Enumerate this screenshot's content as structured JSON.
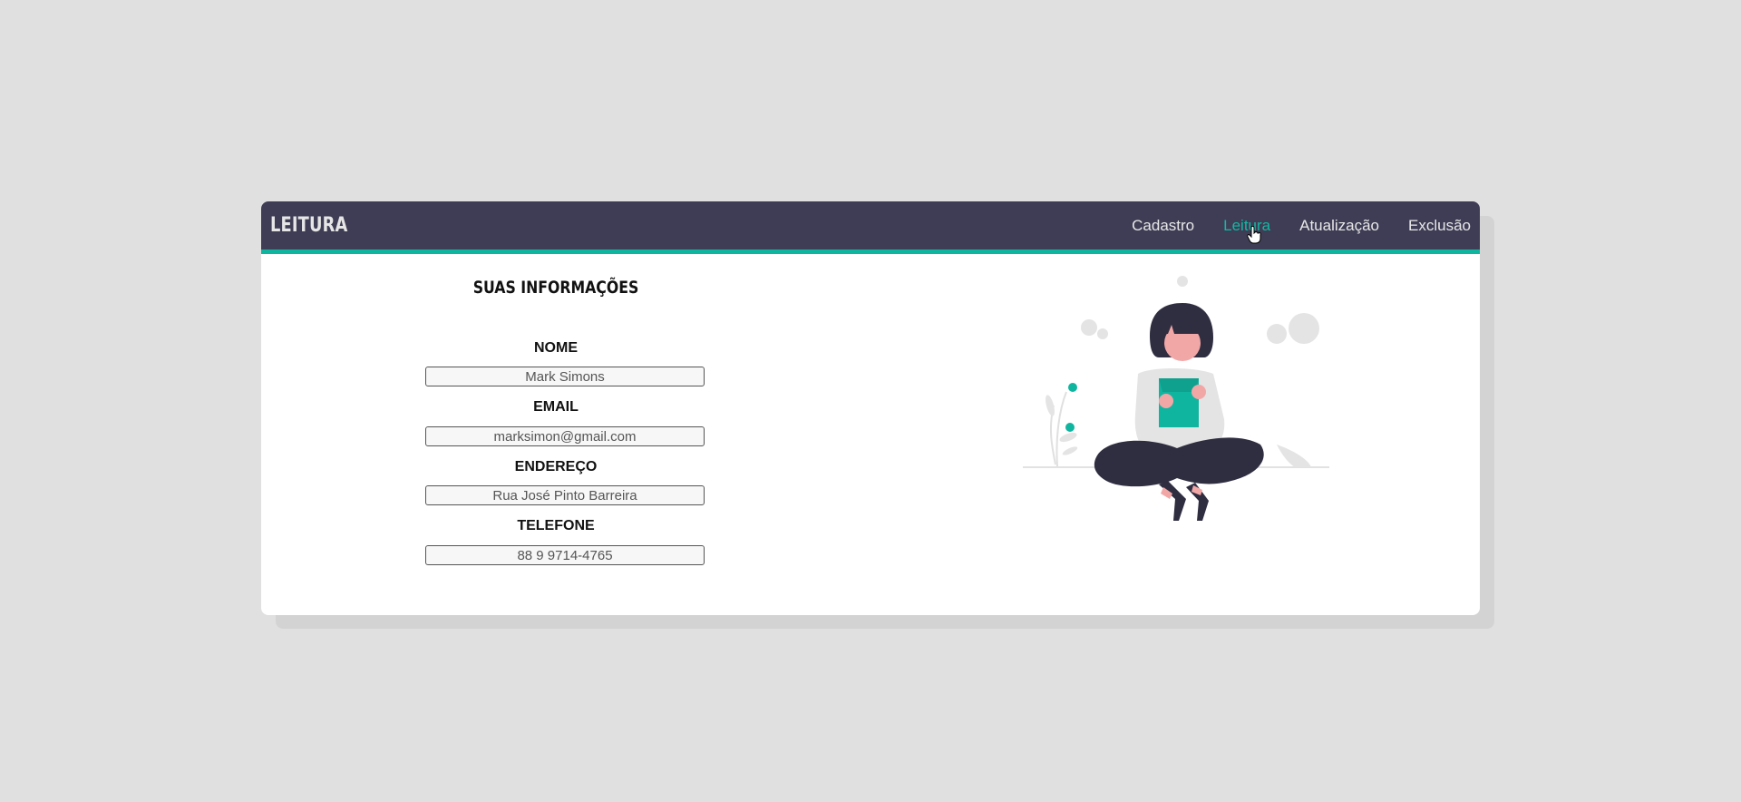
{
  "header": {
    "title": "LEITURA",
    "nav": [
      {
        "label": "Cadastro",
        "active": false
      },
      {
        "label": "Leitura",
        "active": true
      },
      {
        "label": "Atualização",
        "active": false
      },
      {
        "label": "Exclusão",
        "active": false
      }
    ]
  },
  "form": {
    "section_title": "SUAS INFORMAÇÕES",
    "fields": [
      {
        "label": "NOME",
        "value": "Mark Simons"
      },
      {
        "label": "EMAIL",
        "value": "marksimon@gmail.com"
      },
      {
        "label": "ENDEREÇO",
        "value": "Rua José Pinto Barreira"
      },
      {
        "label": "TELEFONE",
        "value": "88 9 9714-4765"
      }
    ]
  },
  "illustration": {
    "icon": "woman-reading-illustration"
  },
  "colors": {
    "navbar": "#3e3d55",
    "accent": "#10b5a0",
    "background": "#e0e0e0",
    "card": "#ffffff"
  }
}
